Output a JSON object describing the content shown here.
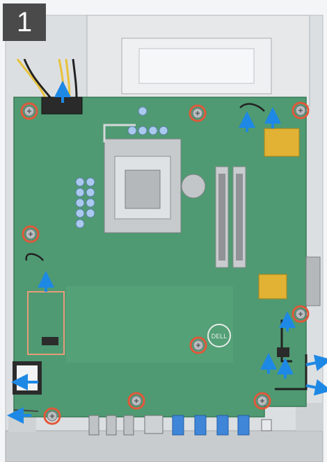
{
  "step": {
    "number": "1"
  },
  "colors": {
    "board_green": "#4f9a72",
    "chassis_gray": "#d7dadc",
    "screw_ring": "#e2573a",
    "arrow_blue": "#1e88e5",
    "badge_bg": "#4a4a4a"
  },
  "board": {
    "logo_text": "DELL"
  },
  "screws": {
    "count": 9,
    "ring_color": "#e2573a"
  },
  "arrows": {
    "count": 14,
    "color": "#1e88e5"
  }
}
